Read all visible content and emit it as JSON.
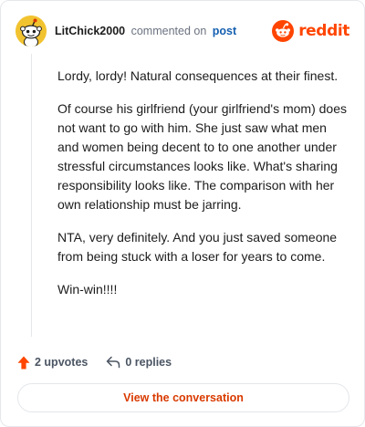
{
  "header": {
    "username": "LitChick2000",
    "action": "commented on",
    "post_link": "post",
    "brand": "reddit",
    "avatar_icon": "snoo-avatar-icon",
    "brand_icon": "reddit-logo-icon"
  },
  "comment": {
    "paragraphs": [
      "Lordy, lordy! Natural consequences at their finest.",
      "Of course his girlfriend (your girlfriend's mom) does not want to go with him. She just saw what men and women being decent to to one another under stressful circumstances looks like. What's sharing responsibility looks like. The comparison with her own relationship must be jarring.",
      "NTA, very definitely. And you just saved someone from being stuck with a loser for years to come.",
      "Win-win!!!!"
    ]
  },
  "actions": {
    "upvotes": "2 upvotes",
    "upvote_icon": "upvote-arrow-icon",
    "replies": "0 replies",
    "reply_icon": "reply-arrow-icon"
  },
  "footer": {
    "view_conversation": "View the conversation"
  },
  "colors": {
    "brand": "#ff4500",
    "link": "#155fb0",
    "button_text": "#d93a00",
    "avatar_background": "#f2c330"
  }
}
